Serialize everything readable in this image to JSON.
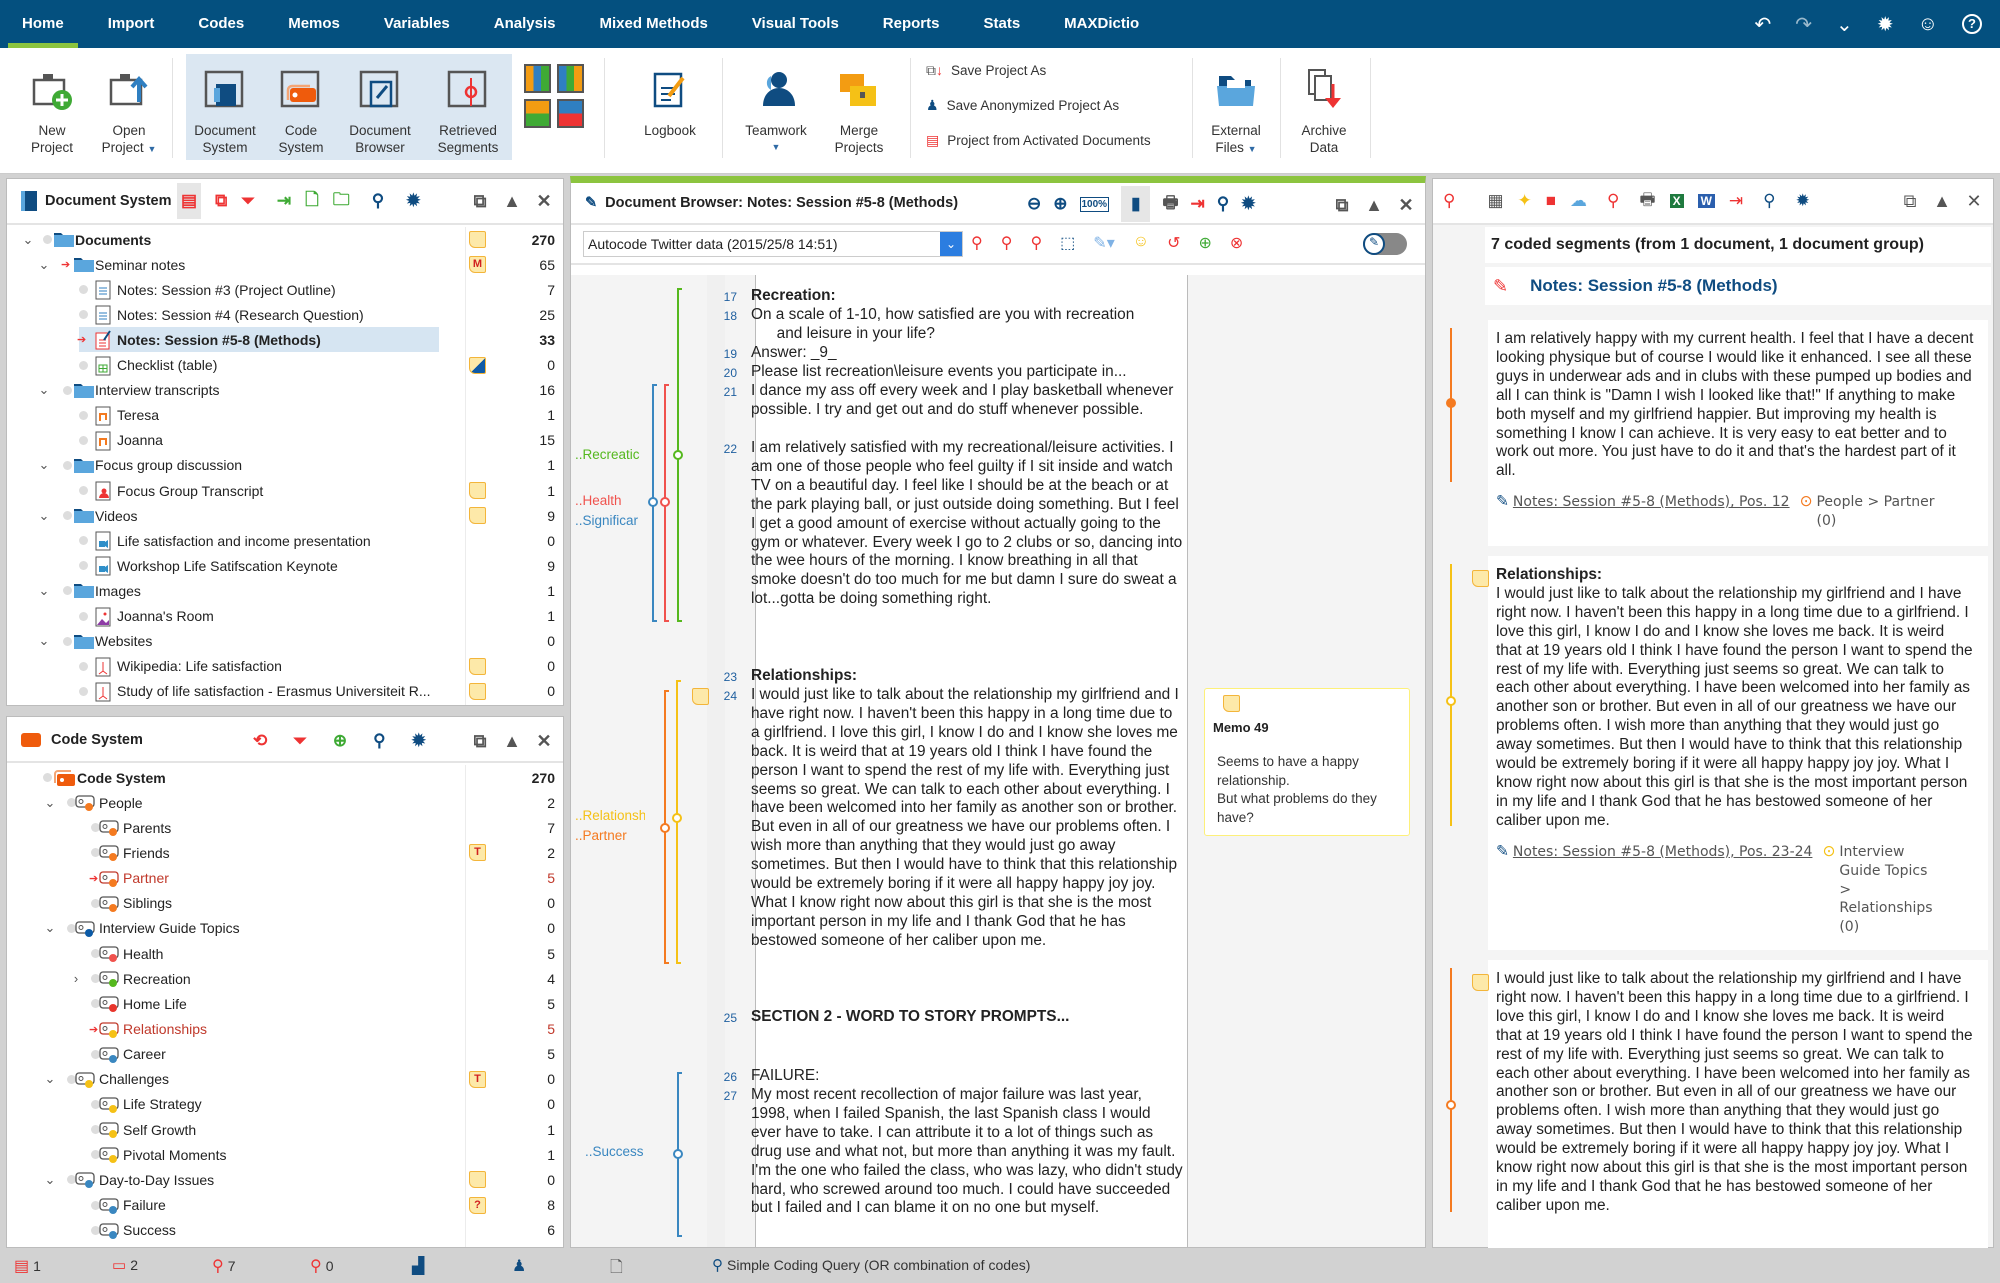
{
  "menu": {
    "tabs": [
      "Home",
      "Import",
      "Codes",
      "Memos",
      "Variables",
      "Analysis",
      "Mixed Methods",
      "Visual Tools",
      "Reports",
      "Stats",
      "MAXDictio"
    ],
    "active_tab": "Home",
    "right_icons": [
      "undo-icon",
      "redo-icon",
      "chevron-down-icon",
      "gear-icon",
      "smiley-icon",
      "help-icon"
    ]
  },
  "ribbon": {
    "new_project": [
      "New",
      "Project"
    ],
    "open_project": [
      "Open",
      "Project"
    ],
    "document_system": [
      "Document",
      "System"
    ],
    "code_system": [
      "Code",
      "System"
    ],
    "document_browser": [
      "Document",
      "Browser"
    ],
    "retrieved_segments": [
      "Retrieved",
      "Segments"
    ],
    "logbook": "Logbook",
    "teamwork": "Teamwork",
    "merge_projects": [
      "Merge",
      "Projects"
    ],
    "save_project_as": "Save Project As",
    "save_anonymized": "Save Anonymized Project As",
    "project_from_activated": "Project from Activated Documents",
    "external_files": [
      "External",
      "Files"
    ],
    "archive_data": [
      "Archive",
      "Data"
    ]
  },
  "document_system": {
    "title": "Document System",
    "rows": [
      {
        "label": "Documents",
        "count": "270",
        "level": 0,
        "type": "folder",
        "expanded": true,
        "bold": true,
        "memo": "plain"
      },
      {
        "label": "Seminar notes",
        "count": "65",
        "level": 1,
        "type": "folder",
        "expanded": true,
        "arrow": true,
        "memo": "M"
      },
      {
        "label": "Notes: Session #3 (Project Outline)",
        "count": "7",
        "level": 2,
        "type": "text"
      },
      {
        "label": "Notes: Session #4 (Research Question)",
        "count": "25",
        "level": 2,
        "type": "text"
      },
      {
        "label": "Notes: Session #5-8 (Methods)",
        "count": "33",
        "level": 2,
        "type": "text-open",
        "selected": true,
        "bold": true,
        "arrow": true
      },
      {
        "label": "Checklist (table)",
        "count": "0",
        "level": 2,
        "type": "table",
        "memo": "blue"
      },
      {
        "label": "Interview transcripts",
        "count": "16",
        "level": 1,
        "type": "folder",
        "expanded": true
      },
      {
        "label": "Teresa",
        "count": "1",
        "level": 2,
        "type": "audio"
      },
      {
        "label": "Joanna",
        "count": "15",
        "level": 2,
        "type": "audio"
      },
      {
        "label": "Focus group discussion",
        "count": "1",
        "level": 1,
        "type": "folder",
        "expanded": true
      },
      {
        "label": "Focus Group Transcript",
        "count": "1",
        "level": 2,
        "type": "focus",
        "collapsed": true,
        "memo": "plain"
      },
      {
        "label": "Videos",
        "count": "9",
        "level": 1,
        "type": "folder",
        "expanded": true,
        "memo": "plain"
      },
      {
        "label": "Life satisfaction and income presentation",
        "count": "0",
        "level": 2,
        "type": "video"
      },
      {
        "label": "Workshop Life Satifscation Keynote",
        "count": "9",
        "level": 2,
        "type": "video"
      },
      {
        "label": "Images",
        "count": "1",
        "level": 1,
        "type": "folder",
        "expanded": true
      },
      {
        "label": "Joanna's Room",
        "count": "1",
        "level": 2,
        "type": "image"
      },
      {
        "label": "Websites",
        "count": "0",
        "level": 1,
        "type": "folder",
        "expanded": true
      },
      {
        "label": "Wikipedia: Life satisfaction",
        "count": "0",
        "level": 2,
        "type": "pdf",
        "memo": "plain"
      },
      {
        "label": "Study of life satisfaction - Erasmus Universiteit R...",
        "count": "0",
        "level": 2,
        "type": "pdf",
        "memo": "plain"
      }
    ]
  },
  "code_system": {
    "title": "Code System",
    "rows": [
      {
        "label": "Code System",
        "count": "270",
        "level": 0,
        "root": true,
        "bold": true
      },
      {
        "label": "People",
        "count": "2",
        "level": 1,
        "color": "#f47a20",
        "expanded": true
      },
      {
        "label": "Parents",
        "count": "7",
        "level": 2,
        "color": "#f47a20"
      },
      {
        "label": "Friends",
        "count": "2",
        "level": 2,
        "color": "#f47a20",
        "memo": "T"
      },
      {
        "label": "Partner",
        "count": "5",
        "level": 2,
        "color": "#f47a20",
        "active": true
      },
      {
        "label": "Siblings",
        "count": "0",
        "level": 2,
        "color": "#f47a20"
      },
      {
        "label": "Interview Guide Topics",
        "count": "0",
        "level": 1,
        "color": "#0b5aa6",
        "expanded": true
      },
      {
        "label": "Health",
        "count": "5",
        "level": 2,
        "color": "#f0524d"
      },
      {
        "label": "Recreation",
        "count": "4",
        "level": 2,
        "color": "#55b81e",
        "collapsed": true
      },
      {
        "label": "Home Life",
        "count": "5",
        "level": 2,
        "color": "#e8352c"
      },
      {
        "label": "Relationships",
        "count": "5",
        "level": 2,
        "color": "#f5c116",
        "active": true
      },
      {
        "label": "Career",
        "count": "5",
        "level": 2,
        "color": "#3a87c0"
      },
      {
        "label": "Challenges",
        "count": "0",
        "level": 1,
        "color": "#f5c116",
        "expanded": true,
        "memo": "T"
      },
      {
        "label": "Life Strategy",
        "count": "0",
        "level": 2,
        "color": "#f5c116"
      },
      {
        "label": "Self Growth",
        "count": "1",
        "level": 2,
        "color": "#f5c116"
      },
      {
        "label": "Pivotal Moments",
        "count": "1",
        "level": 2,
        "color": "#f5c116"
      },
      {
        "label": "Day-to-Day Issues",
        "count": "0",
        "level": 1,
        "color": "#3a87c0",
        "expanded": true,
        "memo": "plain"
      },
      {
        "label": "Failure",
        "count": "8",
        "level": 2,
        "color": "#3a87c0",
        "memo": "?"
      },
      {
        "label": "Success",
        "count": "6",
        "level": 2,
        "color": "#3a87c0"
      }
    ]
  },
  "document_browser": {
    "title": "Document Browser: Notes: Session #5-8 (Methods)",
    "autocode_select": "Autocode Twitter data (2015/25/8 14:51)",
    "paragraphs": [
      {
        "num": "17",
        "text": "Recreation:",
        "bold": true
      },
      {
        "num": "18",
        "text": "On a scale of 1-10, how satisfied are you with recreation\n      and leisure in your life?"
      },
      {
        "num": "19",
        "text": "Answer: _9_"
      },
      {
        "num": "20",
        "text": "Please list recreation\\leisure events you participate in..."
      },
      {
        "num": "21",
        "text": "I dance my ass off every week and I play basketball whenever possible.  I try and get out and do stuff whenever possible."
      },
      {
        "num": "22",
        "text": "   I am relatively satisfied with my recreational/leisure activities.  I am one of those people who feel guilty if I sit inside and watch TV on a beautiful day.  I feel like I should be at the beach or at the park playing ball, or just outside doing something.  But I feel I get a good amount of exercise without actually going to the gym or whatever.  Every week I go to 2 clubs or so, dancing into the wee hours of the morning.  I know breathing in all that smoke doesn't do too much for me but damn I sure do sweat a lot...gotta be doing something right."
      },
      {
        "num": "23",
        "text": "Relationships:",
        "bold": true
      },
      {
        "num": "24",
        "text": "I would just like to talk about the relationship my girlfriend and I have right now.  I haven't been this happy in a long time due to a girlfriend.  I love this girl, I know I do and I know she loves me back.  It is weird that at 19 years old I think I have found the person I want to spend the rest of my life with.  Everything just seems so great.  We can talk to each other about everything.  I have been welcomed into her family as another son or brother.  But even in all of our greatness we have our problems often.  I wish more than anything that they would just go away sometimes.  But then I would have to think that this relationship would be extremely boring if it were all happy happy joy joy.  What I know right now about this girl is that she is the most important person in my life and I thank God that he has bestowed someone of her caliber upon me."
      },
      {
        "num": "25",
        "text": "SECTION 2 - WORD TO STORY PROMPTS...",
        "bold": true
      },
      {
        "num": "26",
        "text": "FAILURE:"
      },
      {
        "num": "27",
        "text": "My most recent recollection of major failure was last year, 1998, when I failed Spanish, the last Spanish class I would ever have to take.  I can attribute it to a lot of things such as drug use and what not, but more than anything it was my fault.  I'm the one who failed the class, who was lazy, who didn't study hard, who screwed around too much.  I could have succeeded but I failed and I can blame it on no one but myself."
      }
    ],
    "code_labels": {
      "recreation": "..Recreatic",
      "health": "..Health",
      "significant": "..Significar",
      "relationships": "..Relationshi",
      "partner": "..Partner",
      "success": "..Success"
    },
    "colors": {
      "recreation": "#55b81e",
      "health": "#f0524d",
      "significant": "#3a87c0",
      "relationships": "#f5c116",
      "partner": "#f47a20",
      "success": "#3a87c0"
    },
    "memo": {
      "title": "Memo 49",
      "text": "Seems to have a happy relationship.\nBut what problems do they have?"
    }
  },
  "retrieved_segments": {
    "summary": "7 coded segments (from 1 document, 1 document group)",
    "document": "Notes: Session #5-8 (Methods)",
    "segments": [
      {
        "text": "I am relatively happy with my current health.  I feel that I have a decent looking physique but of course I would like it enhanced.  I see all these guys in underwear ads and in clubs with these pumped up bodies and all I can think is \"Damn I wish I looked like that!\"  If anything to make both myself and my girlfriend happier.  But improving my health is something I know I can achieve.  It is very easy to eat better and to work out more.  You just have to do it and that's the hardest part of it all.",
        "source": "Notes: Session #5-8 (Methods), Pos. 12",
        "code": "People > Partner (0)",
        "color": "#f47a20"
      },
      {
        "heading": "Relationships:",
        "text": "I would just like to talk about the relationship my girlfriend and I have right now.  I haven't been this happy in a long time due to a girlfriend.  I love this girl, I know I do and I know she loves me back.  It is weird that at 19 years old I think I have found the person I want to spend the rest of my life with.  Everything just seems so great.  We can talk to each other about everything.  I have been welcomed into her family as another son or brother.  But even in all of our greatness we have our problems often.  I wish more than anything that they would just go away sometimes.  But then I would have to think that this relationship would be extremely boring if it were all happy happy joy joy.  What I know right now about this girl is that she is the most important person in my life and I thank God that he has bestowed someone of her caliber upon me.",
        "source": "Notes: Session #5-8 (Methods), Pos. 23-24",
        "code": "Interview Guide Topics > Relationships (0)",
        "color": "#f5c116"
      },
      {
        "text": "I would just like to talk about the relationship my girlfriend and I have right now.  I haven't been this happy in a long time due to a girlfriend.  I love this girl, I know I do and I know she loves me back.  It is weird that at 19 years old I think I have found the person I want to spend the rest of my life with.  Everything just seems so great.  We can talk to each other about everything.  I have been welcomed into her family as another son or brother.  But even in all of our greatness we have our problems often.  I wish more than anything that they would just go away sometimes.  But then I would have to think that this relationship would be extremely boring if it were all happy happy joy joy.  What I know right now about this girl is that she is the most important person in my life and I thank God that he has bestowed someone of her caliber upon me.",
        "color": "#f47a20"
      }
    ]
  },
  "status_bar": {
    "documents": "1",
    "codes": "2",
    "segments": "7",
    "weight": "0",
    "query": "Simple Coding Query (OR combination of codes)"
  }
}
